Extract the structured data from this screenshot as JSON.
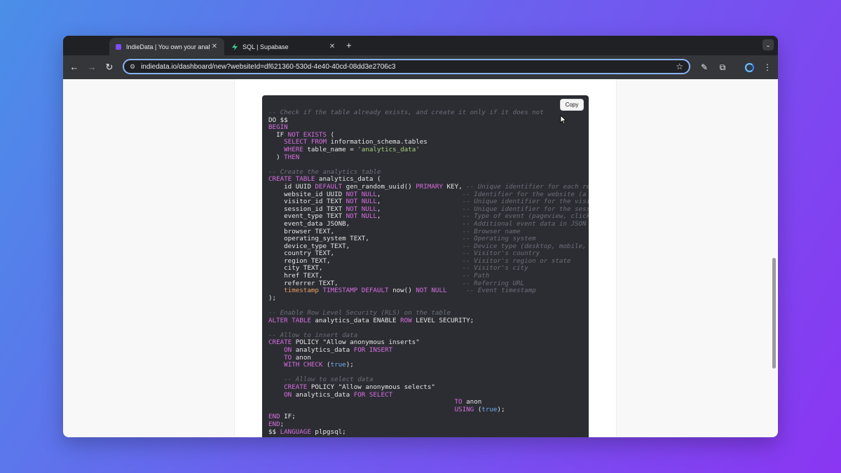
{
  "browser": {
    "tabs": [
      {
        "title": "IndieData | You own your analytics",
        "active": true,
        "favicon": "indiedata-favicon"
      },
      {
        "title": "SQL | Supabase",
        "active": false,
        "favicon": "supabase-bolt-icon"
      }
    ],
    "new_tab": "+",
    "url": "indiedata.io/dashboard/new?websiteId=df621360-530d-4e40-40cd-08dd3e2706c3"
  },
  "code": {
    "copy_label": "Copy",
    "lines": [
      [
        [
          "c",
          "-- Check if the table already exists, and create it only if it does not"
        ]
      ],
      [
        [
          "t",
          "DO $$"
        ]
      ],
      [
        [
          "k",
          "BEGIN"
        ]
      ],
      [
        [
          "t",
          "  IF "
        ],
        [
          "k",
          "NOT EXISTS"
        ],
        [
          "t",
          " ("
        ]
      ],
      [
        [
          "t",
          "    "
        ],
        [
          "k",
          "SELECT FROM"
        ],
        [
          "t",
          " information_schema.tables"
        ]
      ],
      [
        [
          "t",
          "    "
        ],
        [
          "k",
          "WHERE"
        ],
        [
          "t",
          " table_name = "
        ],
        [
          "s",
          "'analytics_data'"
        ]
      ],
      [
        [
          "t",
          "  ) "
        ],
        [
          "k",
          "THEN"
        ]
      ],
      [
        [
          "t",
          ""
        ]
      ],
      [
        [
          "c",
          "-- Create the analytics table"
        ]
      ],
      [
        [
          "k",
          "CREATE TABLE"
        ],
        [
          "t",
          " analytics_data ("
        ]
      ],
      [
        [
          "t",
          "    id UUID "
        ],
        [
          "k",
          "DEFAULT"
        ],
        [
          "t",
          " gen_random_uuid() "
        ],
        [
          "k",
          "PRIMARY"
        ],
        [
          "t",
          " KEY, "
        ],
        [
          "c",
          "-- Unique identifier for each record"
        ]
      ],
      [
        [
          "t",
          "    website_id UUID "
        ],
        [
          "k",
          "NOT NULL"
        ],
        [
          "t",
          ",                     "
        ],
        [
          "c",
          "-- Identifier for the website (a"
        ]
      ],
      [
        [
          "t",
          "    visitor_id TEXT "
        ],
        [
          "k",
          "NOT NULL"
        ],
        [
          "t",
          ",                     "
        ],
        [
          "c",
          "-- Unique identifier for the visitor"
        ]
      ],
      [
        [
          "t",
          "    session_id TEXT "
        ],
        [
          "k",
          "NOT NULL"
        ],
        [
          "t",
          ",                     "
        ],
        [
          "c",
          "-- Unique identifier for the session"
        ]
      ],
      [
        [
          "t",
          "    event_type TEXT "
        ],
        [
          "k",
          "NOT NULL"
        ],
        [
          "t",
          ",                     "
        ],
        [
          "c",
          "-- Type of event (pageview, click"
        ]
      ],
      [
        [
          "t",
          "    event_data JSONB,                             "
        ],
        [
          "c",
          "-- Additional event data in JSON"
        ]
      ],
      [
        [
          "t",
          "    browser TEXT,                                 "
        ],
        [
          "c",
          "-- Browser name"
        ]
      ],
      [
        [
          "t",
          "    operating_system TEXT,                        "
        ],
        [
          "c",
          "-- Operating system"
        ]
      ],
      [
        [
          "t",
          "    device_type TEXT,                             "
        ],
        [
          "c",
          "-- Device type (desktop, mobile,"
        ]
      ],
      [
        [
          "t",
          "    country TEXT,                                 "
        ],
        [
          "c",
          "-- Visitor's country"
        ]
      ],
      [
        [
          "t",
          "    region TEXT,                                  "
        ],
        [
          "c",
          "-- Visitor's region or state"
        ]
      ],
      [
        [
          "t",
          "    city TEXT,                                    "
        ],
        [
          "c",
          "-- Visitor's city"
        ]
      ],
      [
        [
          "t",
          "    href TEXT,                                    "
        ],
        [
          "c",
          "-- Path"
        ]
      ],
      [
        [
          "t",
          "    referrer TEXT,                                "
        ],
        [
          "c",
          "-- Referring URL"
        ]
      ],
      [
        [
          "t",
          "    "
        ],
        [
          "o",
          "timestamp"
        ],
        [
          "t",
          " "
        ],
        [
          "k",
          "TIMESTAMP DEFAULT"
        ],
        [
          "t",
          " now() "
        ],
        [
          "k",
          "NOT NULL"
        ],
        [
          "t",
          "     "
        ],
        [
          "c",
          "-- Event timestamp"
        ]
      ],
      [
        [
          "t",
          ");"
        ]
      ],
      [
        [
          "t",
          ""
        ]
      ],
      [
        [
          "c",
          "-- Enable Row Level Security (RLS) on the table"
        ]
      ],
      [
        [
          "k",
          "ALTER TABLE"
        ],
        [
          "t",
          " analytics_data ENABLE "
        ],
        [
          "k",
          "ROW"
        ],
        [
          "t",
          " LEVEL SECURITY;"
        ]
      ],
      [
        [
          "t",
          ""
        ]
      ],
      [
        [
          "c",
          "-- Allow to insert data"
        ]
      ],
      [
        [
          "k",
          "CREATE"
        ],
        [
          "t",
          " POLICY \"Allow anonymous inserts\""
        ]
      ],
      [
        [
          "t",
          "    "
        ],
        [
          "k",
          "ON"
        ],
        [
          "t",
          " analytics_data "
        ],
        [
          "k",
          "FOR INSERT"
        ]
      ],
      [
        [
          "t",
          "    "
        ],
        [
          "k",
          "TO"
        ],
        [
          "t",
          " anon"
        ]
      ],
      [
        [
          "t",
          "    "
        ],
        [
          "k",
          "WITH CHECK"
        ],
        [
          "t",
          " ("
        ],
        [
          "b",
          "true"
        ],
        [
          "t",
          ");"
        ]
      ],
      [
        [
          "t",
          ""
        ]
      ],
      [
        [
          "t",
          "    "
        ],
        [
          "c",
          "-- Allow to select data"
        ]
      ],
      [
        [
          "t",
          "    "
        ],
        [
          "k",
          "CREATE"
        ],
        [
          "t",
          " POLICY \"Allow anonymous selects\""
        ]
      ],
      [
        [
          "t",
          "    "
        ],
        [
          "k",
          "ON"
        ],
        [
          "t",
          " analytics_data "
        ],
        [
          "k",
          "FOR SELECT"
        ]
      ],
      [
        [
          "t",
          "                                                "
        ],
        [
          "k",
          "TO"
        ],
        [
          "t",
          " anon"
        ]
      ],
      [
        [
          "t",
          "                                                "
        ],
        [
          "k",
          "USING"
        ],
        [
          "t",
          " ("
        ],
        [
          "b",
          "true"
        ],
        [
          "t",
          ");"
        ]
      ],
      [
        [
          "k",
          "END"
        ],
        [
          "t",
          " IF;"
        ]
      ],
      [
        [
          "k",
          "END"
        ],
        [
          "t",
          ";"
        ]
      ],
      [
        [
          "t",
          "$$ "
        ],
        [
          "k",
          "LANGUAGE"
        ],
        [
          "t",
          " plpgsql;"
        ]
      ]
    ]
  }
}
